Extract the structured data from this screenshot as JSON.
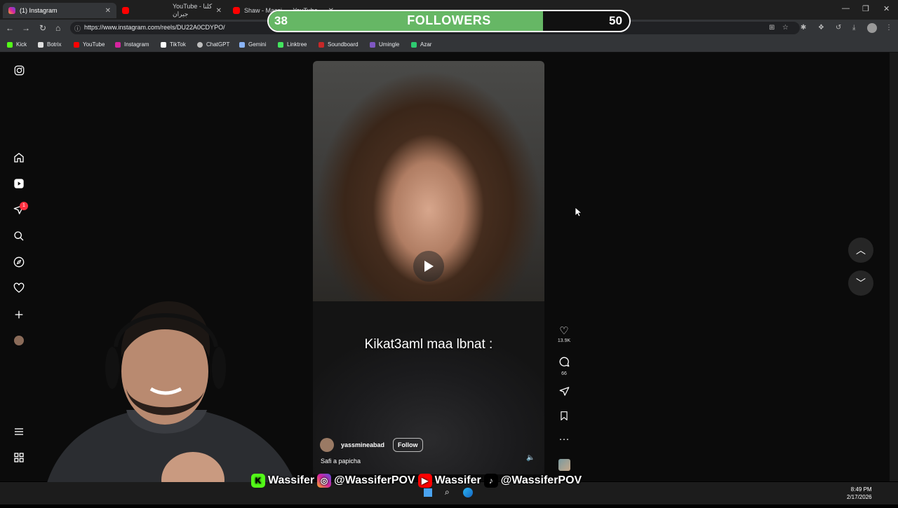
{
  "browser": {
    "tabs": [
      {
        "label": "(1) Instagram",
        "icon": "instagram-icon",
        "active": true
      },
      {
        "label": "YouTube - كلنا جيران",
        "icon": "youtube-icon",
        "active": false
      },
      {
        "label": "Shaw - Massi... - YouTube",
        "icon": "youtube-icon",
        "active": false
      }
    ],
    "url": "https://www.instagram.com/reels/DU22A0CDYPO/",
    "bookmarks": [
      {
        "label": "Kick",
        "color": "#53fc18"
      },
      {
        "label": "Botrix",
        "color": "#e0e0e0"
      },
      {
        "label": "YouTube",
        "color": "#ff0000"
      },
      {
        "label": "Instagram",
        "color": "#d6249f"
      },
      {
        "label": "TikTok",
        "color": "#ffffff"
      },
      {
        "label": "ChatGPT",
        "color": "#bfbfbf"
      },
      {
        "label": "Gemini",
        "color": "#8ab4f8"
      },
      {
        "label": "Linktree",
        "color": "#43e55e"
      },
      {
        "label": "Soundboard",
        "color": "#c62828"
      },
      {
        "label": "Umingle",
        "color": "#7e57c2"
      },
      {
        "label": "Azar",
        "color": "#2ecc71"
      }
    ]
  },
  "overlay": {
    "followers_current": "38",
    "followers_label": "FOLLOWERS",
    "followers_goal": "50",
    "progress_fraction": 0.76,
    "accent": "#66b765"
  },
  "instagram": {
    "sidebar_icons": [
      "instagram-logo-icon",
      "home-icon",
      "reels-icon",
      "messages-icon",
      "search-icon",
      "explore-icon",
      "notifications-icon",
      "create-icon",
      "profile-icon",
      "menu-icon",
      "more-apps-icon"
    ],
    "messages_badge": "1",
    "reel": {
      "caption_overlay": "Kikat3aml maa lbnat :",
      "username": "yassmineabad",
      "follow_label": "Follow",
      "description": "Safi a papicha"
    },
    "actions": {
      "likes": "13.9K",
      "comments": "66"
    }
  },
  "stream": {
    "social": [
      {
        "platform": "kick-icon",
        "handle": "Wassifer",
        "color": "#53fc18"
      },
      {
        "platform": "instagram-icon",
        "handle": "@WassiferPOV",
        "color": "#d6249f"
      },
      {
        "platform": "youtube-icon",
        "handle": "Wassifer",
        "color": "#ff0000"
      },
      {
        "platform": "tiktok-icon",
        "handle": "@WassiferPOV",
        "color": "#000000"
      }
    ]
  },
  "taskbar": {
    "time": "8:49 PM",
    "date": "2/17/2026"
  }
}
